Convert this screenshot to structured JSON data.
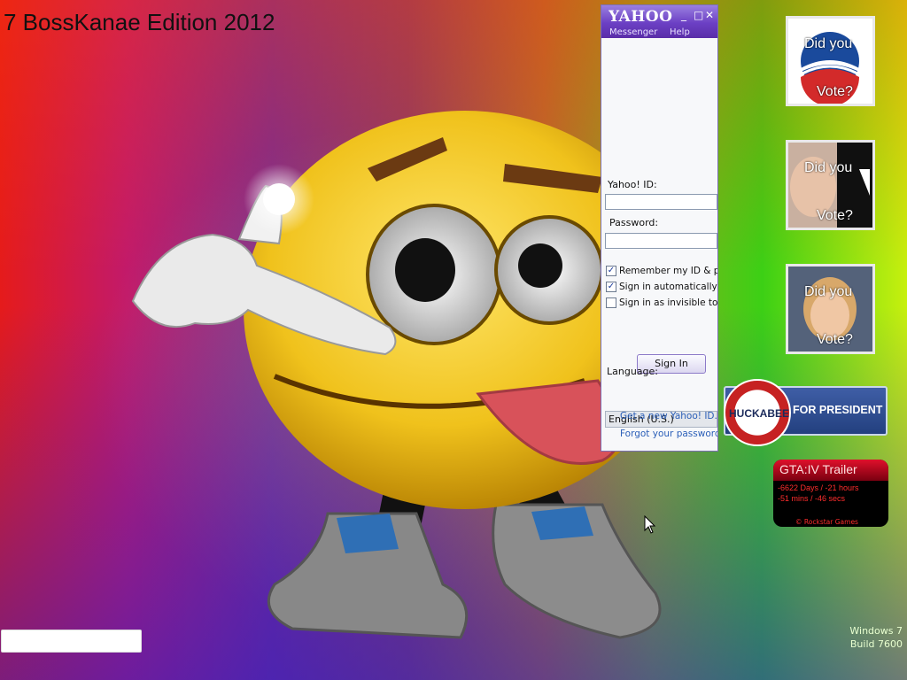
{
  "desktop": {
    "title": "7 BossKanae Edition 2012"
  },
  "yahoo_messenger": {
    "logo": "YAHOO!",
    "window_controls": {
      "minimize": "_",
      "maximize": "□",
      "close": "✕"
    },
    "menu": [
      "Messenger",
      "Help"
    ],
    "id_label": "Yahoo! ID:",
    "id_value": "",
    "password_label": "Password:",
    "password_value": "",
    "checkboxes": [
      {
        "label": "Remember my ID & password",
        "checked": true
      },
      {
        "label": "Sign in automatically",
        "checked": true
      },
      {
        "label": "Sign in as invisible to everyone",
        "checked": false
      }
    ],
    "signin_button": "Sign In",
    "language_label": "Language:",
    "language_value": "English (U.S.)",
    "links": [
      "Get a new Yahoo! ID...",
      "Forgot your password?"
    ]
  },
  "tiles": [
    {
      "caption_top": "Did you",
      "caption_bottom": "Vote?"
    },
    {
      "caption_top": "Did you",
      "caption_bottom": "Vote?"
    },
    {
      "caption_top": "Did you",
      "caption_bottom": "Vote?"
    }
  ],
  "huckabee": {
    "name": "HUCKABEE",
    "slogan": "FOR PRESIDENT"
  },
  "gta": {
    "title": "GTA:IV Trailer",
    "line1": "-6622 Days / -21 hours",
    "line2": "-51 mins / -46 secs",
    "copyright": "© Rockstar Games"
  },
  "watermark": {
    "line1": "Windows 7",
    "line2": "Build 7600"
  },
  "colors": {
    "yahoo_purple": "#6b3fc4",
    "link_blue": "#2b5fb8",
    "gta_red": "#e0102b"
  }
}
